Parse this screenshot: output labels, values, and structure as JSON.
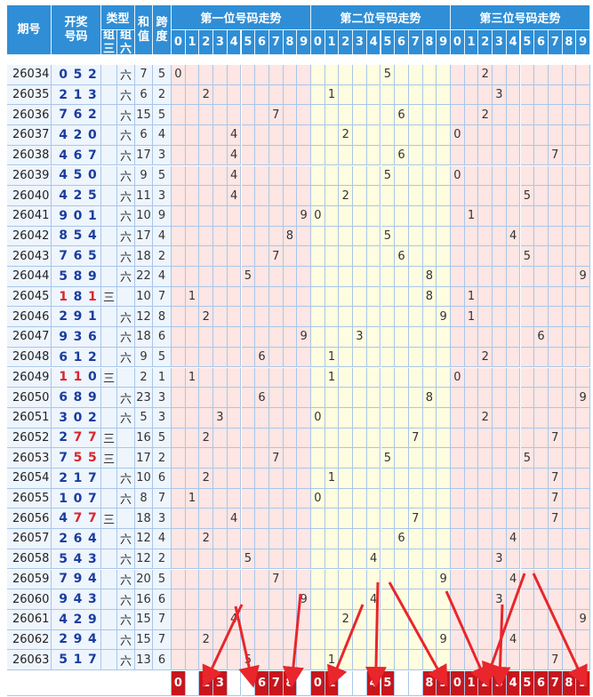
{
  "headers": {
    "issue": "期号",
    "draw": "开奖\n号码",
    "type": "类型",
    "type3": "组\n三",
    "type6": "组\n六",
    "sum": "和\n值",
    "span": "跨\n度",
    "pos1": "第一位号码走势",
    "pos2": "第二位号码走势",
    "pos3": "第三位号码走势",
    "digits": [
      "0",
      "1",
      "2",
      "3",
      "4",
      "5",
      "6",
      "7",
      "8",
      "9"
    ]
  },
  "chart_data": {
    "type": "table",
    "rows": [
      {
        "issue": "26034",
        "draw": "052",
        "type3": "",
        "type6": "六",
        "sum": "7",
        "span": "5"
      },
      {
        "issue": "26035",
        "draw": "213",
        "type3": "",
        "type6": "六",
        "sum": "6",
        "span": "2"
      },
      {
        "issue": "26036",
        "draw": "762",
        "type3": "",
        "type6": "六",
        "sum": "15",
        "span": "5"
      },
      {
        "issue": "26037",
        "draw": "420",
        "type3": "",
        "type6": "六",
        "sum": "6",
        "span": "4"
      },
      {
        "issue": "26038",
        "draw": "467",
        "type3": "",
        "type6": "六",
        "sum": "17",
        "span": "3"
      },
      {
        "issue": "26039",
        "draw": "450",
        "type3": "",
        "type6": "六",
        "sum": "9",
        "span": "5"
      },
      {
        "issue": "26040",
        "draw": "425",
        "type3": "",
        "type6": "六",
        "sum": "11",
        "span": "3"
      },
      {
        "issue": "26041",
        "draw": "901",
        "type3": "",
        "type6": "六",
        "sum": "10",
        "span": "9"
      },
      {
        "issue": "26042",
        "draw": "854",
        "type3": "",
        "type6": "六",
        "sum": "17",
        "span": "4"
      },
      {
        "issue": "26043",
        "draw": "765",
        "type3": "",
        "type6": "六",
        "sum": "18",
        "span": "2"
      },
      {
        "issue": "26044",
        "draw": "589",
        "type3": "",
        "type6": "六",
        "sum": "22",
        "span": "4"
      },
      {
        "issue": "26045",
        "draw": "181",
        "type3": "三",
        "type6": "",
        "sum": "10",
        "span": "7"
      },
      {
        "issue": "26046",
        "draw": "291",
        "type3": "",
        "type6": "六",
        "sum": "12",
        "span": "8"
      },
      {
        "issue": "26047",
        "draw": "936",
        "type3": "",
        "type6": "六",
        "sum": "18",
        "span": "6"
      },
      {
        "issue": "26048",
        "draw": "612",
        "type3": "",
        "type6": "六",
        "sum": "9",
        "span": "5"
      },
      {
        "issue": "26049",
        "draw": "110",
        "type3": "三",
        "type6": "",
        "sum": "2",
        "span": "1"
      },
      {
        "issue": "26050",
        "draw": "689",
        "type3": "",
        "type6": "六",
        "sum": "23",
        "span": "3"
      },
      {
        "issue": "26051",
        "draw": "302",
        "type3": "",
        "type6": "六",
        "sum": "5",
        "span": "3"
      },
      {
        "issue": "26052",
        "draw": "277",
        "type3": "三",
        "type6": "",
        "sum": "16",
        "span": "5"
      },
      {
        "issue": "26053",
        "draw": "755",
        "type3": "三",
        "type6": "",
        "sum": "17",
        "span": "2"
      },
      {
        "issue": "26054",
        "draw": "217",
        "type3": "",
        "type6": "六",
        "sum": "10",
        "span": "6"
      },
      {
        "issue": "26055",
        "draw": "107",
        "type3": "",
        "type6": "六",
        "sum": "8",
        "span": "7"
      },
      {
        "issue": "26056",
        "draw": "477",
        "type3": "三",
        "type6": "",
        "sum": "18",
        "span": "3"
      },
      {
        "issue": "26057",
        "draw": "264",
        "type3": "",
        "type6": "六",
        "sum": "12",
        "span": "4"
      },
      {
        "issue": "26058",
        "draw": "543",
        "type3": "",
        "type6": "六",
        "sum": "12",
        "span": "2"
      },
      {
        "issue": "26059",
        "draw": "794",
        "type3": "",
        "type6": "六",
        "sum": "20",
        "span": "5"
      },
      {
        "issue": "26060",
        "draw": "943",
        "type3": "",
        "type6": "六",
        "sum": "16",
        "span": "6"
      },
      {
        "issue": "26061",
        "draw": "429",
        "type3": "",
        "type6": "六",
        "sum": "15",
        "span": "7"
      },
      {
        "issue": "26062",
        "draw": "294",
        "type3": "",
        "type6": "六",
        "sum": "15",
        "span": "7"
      },
      {
        "issue": "26063",
        "draw": "517",
        "type3": "",
        "type6": "六",
        "sum": "13",
        "span": "6"
      }
    ],
    "predictions": {
      "pos1": [
        "0",
        "2",
        "3",
        "6",
        "7",
        "8"
      ],
      "pos2": [
        "0",
        "1",
        "4",
        "5",
        "8",
        "9"
      ],
      "pos3": [
        "0",
        "1",
        "2",
        "3",
        "4",
        "5",
        "6",
        "7",
        "8",
        "9"
      ]
    }
  },
  "colors": {
    "header": "#2f8ed6",
    "pos1_bg": "#fde6e4",
    "pos2_bg": "#fffde0",
    "pos3_bg": "#fde6e4",
    "repeat_digit": "#d8262b",
    "draw_digit": "#1a3d9e",
    "prediction_cell": "#c8161d",
    "arrow": "#e8262b"
  }
}
